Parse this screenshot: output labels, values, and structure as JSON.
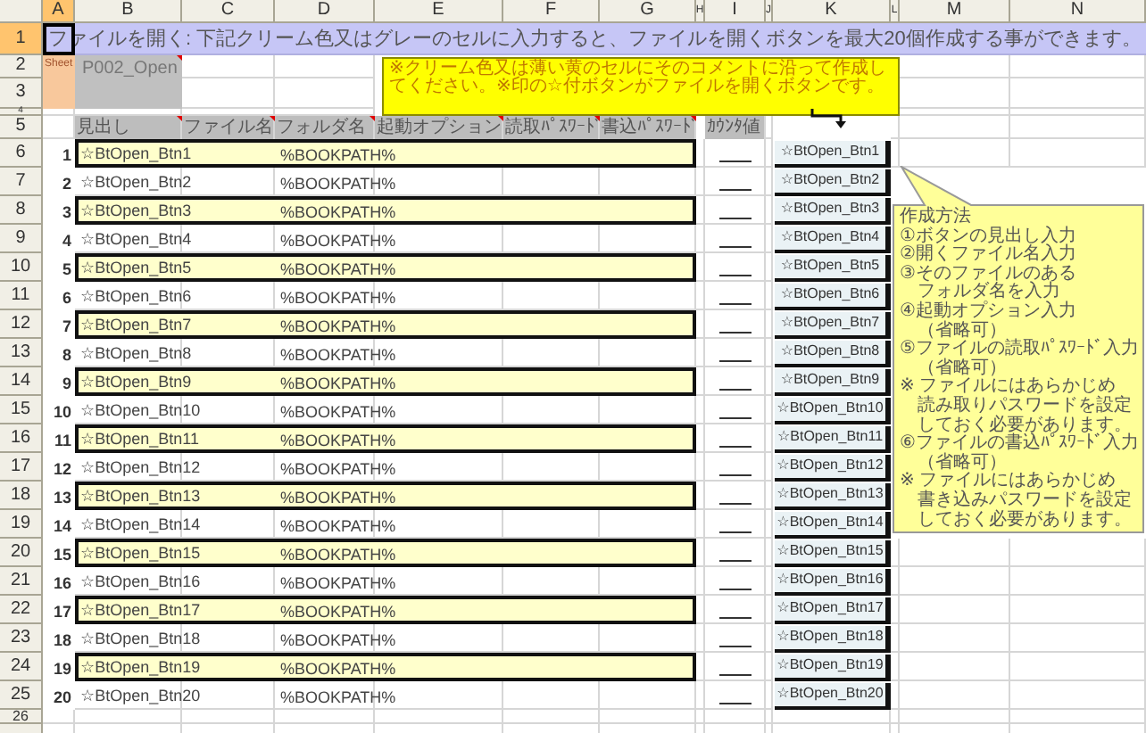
{
  "column_headers": [
    {
      "label": "A",
      "selected": true
    },
    {
      "label": "B",
      "selected": false
    },
    {
      "label": "C",
      "selected": false
    },
    {
      "label": "D",
      "selected": false
    },
    {
      "label": "E",
      "selected": false
    },
    {
      "label": "F",
      "selected": false
    },
    {
      "label": "G",
      "selected": false
    },
    {
      "label": "H",
      "selected": false
    },
    {
      "label": "I",
      "selected": false
    },
    {
      "label": "J",
      "selected": false
    },
    {
      "label": "K",
      "selected": false
    },
    {
      "label": "L",
      "selected": false
    },
    {
      "label": "M",
      "selected": false
    },
    {
      "label": "N",
      "selected": false
    }
  ],
  "row_headers": [
    {
      "label": "1",
      "selected": true
    },
    {
      "label": "2",
      "selected": false
    },
    {
      "label": "3",
      "selected": false
    },
    {
      "label": "4",
      "selected": false
    },
    {
      "label": "5",
      "selected": false
    },
    {
      "label": "6",
      "selected": false
    },
    {
      "label": "7",
      "selected": false
    },
    {
      "label": "8",
      "selected": false
    },
    {
      "label": "9",
      "selected": false
    },
    {
      "label": "10",
      "selected": false
    },
    {
      "label": "11",
      "selected": false
    },
    {
      "label": "12",
      "selected": false
    },
    {
      "label": "13",
      "selected": false
    },
    {
      "label": "14",
      "selected": false
    },
    {
      "label": "15",
      "selected": false
    },
    {
      "label": "16",
      "selected": false
    },
    {
      "label": "17",
      "selected": false
    },
    {
      "label": "18",
      "selected": false
    },
    {
      "label": "19",
      "selected": false
    },
    {
      "label": "20",
      "selected": false
    },
    {
      "label": "21",
      "selected": false
    },
    {
      "label": "22",
      "selected": false
    },
    {
      "label": "23",
      "selected": false
    },
    {
      "label": "24",
      "selected": false
    },
    {
      "label": "25",
      "selected": false
    },
    {
      "label": "26",
      "selected": false
    }
  ],
  "title": "ファイルを開く: 下記クリーム色又はグレーのセルに入力すると、ファイルを開くボタンを最大20個作成する事ができます。",
  "sheet": {
    "label": "Sheet",
    "name": "P002_Open"
  },
  "headers": [
    "見出し",
    "ファイル名",
    "フォルダ名",
    "起動オプション",
    "読取ﾊﾟｽﾜｰﾄﾞ",
    "書込ﾊﾟｽﾜｰﾄﾞ"
  ],
  "counter_header": "ｶｳﾝﾀ値",
  "entries": [
    {
      "number": "1",
      "caption": "☆BtOpen_Btn1",
      "folder": "%BOOKPATH%",
      "highlighted": true
    },
    {
      "number": "2",
      "caption": "☆BtOpen_Btn2",
      "folder": "%BOOKPATH%",
      "highlighted": false
    },
    {
      "number": "3",
      "caption": "☆BtOpen_Btn3",
      "folder": "%BOOKPATH%",
      "highlighted": true
    },
    {
      "number": "4",
      "caption": "☆BtOpen_Btn4",
      "folder": "%BOOKPATH%",
      "highlighted": false
    },
    {
      "number": "5",
      "caption": "☆BtOpen_Btn5",
      "folder": "%BOOKPATH%",
      "highlighted": true
    },
    {
      "number": "6",
      "caption": "☆BtOpen_Btn6",
      "folder": "%BOOKPATH%",
      "highlighted": false
    },
    {
      "number": "7",
      "caption": "☆BtOpen_Btn7",
      "folder": "%BOOKPATH%",
      "highlighted": true
    },
    {
      "number": "8",
      "caption": "☆BtOpen_Btn8",
      "folder": "%BOOKPATH%",
      "highlighted": false
    },
    {
      "number": "9",
      "caption": "☆BtOpen_Btn9",
      "folder": "%BOOKPATH%",
      "highlighted": true
    },
    {
      "number": "10",
      "caption": "☆BtOpen_Btn10",
      "folder": "%BOOKPATH%",
      "highlighted": false
    },
    {
      "number": "11",
      "caption": "☆BtOpen_Btn11",
      "folder": "%BOOKPATH%",
      "highlighted": true
    },
    {
      "number": "12",
      "caption": "☆BtOpen_Btn12",
      "folder": "%BOOKPATH%",
      "highlighted": false
    },
    {
      "number": "13",
      "caption": "☆BtOpen_Btn13",
      "folder": "%BOOKPATH%",
      "highlighted": true
    },
    {
      "number": "14",
      "caption": "☆BtOpen_Btn14",
      "folder": "%BOOKPATH%",
      "highlighted": false
    },
    {
      "number": "15",
      "caption": "☆BtOpen_Btn15",
      "folder": "%BOOKPATH%",
      "highlighted": true
    },
    {
      "number": "16",
      "caption": "☆BtOpen_Btn16",
      "folder": "%BOOKPATH%",
      "highlighted": false
    },
    {
      "number": "17",
      "caption": "☆BtOpen_Btn17",
      "folder": "%BOOKPATH%",
      "highlighted": true
    },
    {
      "number": "18",
      "caption": "☆BtOpen_Btn18",
      "folder": "%BOOKPATH%",
      "highlighted": false
    },
    {
      "number": "19",
      "caption": "☆BtOpen_Btn19",
      "folder": "%BOOKPATH%",
      "highlighted": true
    },
    {
      "number": "20",
      "caption": "☆BtOpen_Btn20",
      "folder": "%BOOKPATH%",
      "highlighted": false
    }
  ],
  "buttons": [
    "☆BtOpen_Btn1",
    "☆BtOpen_Btn2",
    "☆BtOpen_Btn3",
    "☆BtOpen_Btn4",
    "☆BtOpen_Btn5",
    "☆BtOpen_Btn6",
    "☆BtOpen_Btn7",
    "☆BtOpen_Btn8",
    "☆BtOpen_Btn9",
    "☆BtOpen_Btn10",
    "☆BtOpen_Btn11",
    "☆BtOpen_Btn12",
    "☆BtOpen_Btn13",
    "☆BtOpen_Btn14",
    "☆BtOpen_Btn15",
    "☆BtOpen_Btn16",
    "☆BtOpen_Btn17",
    "☆BtOpen_Btn18",
    "☆BtOpen_Btn19",
    "☆BtOpen_Btn20"
  ],
  "note": "※クリーム色又は薄い黄のセルにそのコメントに沿って作成してください。※印の☆付ボタンがファイルを開くボタンです。",
  "callout": {
    "lines": [
      "作成方法",
      "①ボタンの見出し入力",
      "②開くファイル名入力",
      "③そのファイルのある",
      "　フォルダ名を入力",
      "④起動オプション入力",
      "　（省略可）",
      "⑤ファイルの読取ﾊﾟｽﾜｰﾄﾞ入力",
      "　（省略可）",
      "※ ファイルにはあらかじめ",
      "　読み取りパスワードを設定",
      "　しておく必要があります。",
      "⑥ファイルの書込ﾊﾟｽﾜｰﾄﾞ入力",
      "　（省略可）",
      "※ ファイルにはあらかじめ",
      "　書き込みパスワードを設定",
      "　しておく必要があります。"
    ]
  }
}
